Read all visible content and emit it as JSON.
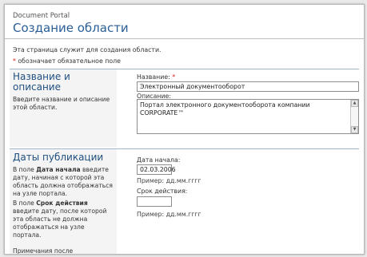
{
  "header": {
    "brand": "Document Portal",
    "title": "Создание области"
  },
  "intro": {
    "description": "Эта страница служит для создания области.",
    "required_marker": "*",
    "required_note": "обозначает обязательное поле"
  },
  "section_name": {
    "title_line1": "Название и",
    "title_line2": "описание",
    "description": "Введите название и описание этой области.",
    "name_label": "Название:",
    "name_value": "Электронный документооборот",
    "desc_label": "Описание:",
    "desc_value": "Портал электронного документооборота компании CORPORATE™"
  },
  "section_dates": {
    "title": "Даты публикации",
    "desc1_pre": "В поле ",
    "desc1_bold": "Дата начала",
    "desc1_post": " введите дату, начиная с которой эта область должна отображаться на узле портала.",
    "desc2_pre": "В поле ",
    "desc2_bold": "Срок действия",
    "desc2_post": " введите дату, после которой эта область не должна отображаться на узле портала.",
    "start_label": "Дата начала:",
    "start_value": "02.03.2006",
    "start_hint": "Пример: дд.мм.гггг",
    "expire_label": "Срок действия:",
    "expire_value": "",
    "expire_hint": "Пример: дд.мм.гггг",
    "cut_text": "Примечания после"
  }
}
